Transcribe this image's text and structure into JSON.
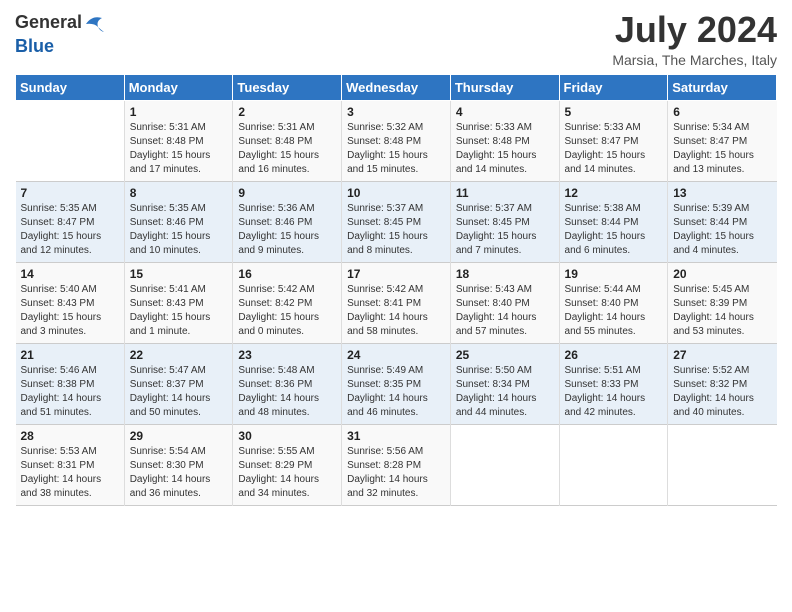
{
  "header": {
    "logo_general": "General",
    "logo_blue": "Blue",
    "month_year": "July 2024",
    "location": "Marsia, The Marches, Italy"
  },
  "days_of_week": [
    "Sunday",
    "Monday",
    "Tuesday",
    "Wednesday",
    "Thursday",
    "Friday",
    "Saturday"
  ],
  "weeks": [
    [
      {
        "num": "",
        "info": ""
      },
      {
        "num": "1",
        "info": "Sunrise: 5:31 AM\nSunset: 8:48 PM\nDaylight: 15 hours\nand 17 minutes."
      },
      {
        "num": "2",
        "info": "Sunrise: 5:31 AM\nSunset: 8:48 PM\nDaylight: 15 hours\nand 16 minutes."
      },
      {
        "num": "3",
        "info": "Sunrise: 5:32 AM\nSunset: 8:48 PM\nDaylight: 15 hours\nand 15 minutes."
      },
      {
        "num": "4",
        "info": "Sunrise: 5:33 AM\nSunset: 8:48 PM\nDaylight: 15 hours\nand 14 minutes."
      },
      {
        "num": "5",
        "info": "Sunrise: 5:33 AM\nSunset: 8:47 PM\nDaylight: 15 hours\nand 14 minutes."
      },
      {
        "num": "6",
        "info": "Sunrise: 5:34 AM\nSunset: 8:47 PM\nDaylight: 15 hours\nand 13 minutes."
      }
    ],
    [
      {
        "num": "7",
        "info": "Sunrise: 5:35 AM\nSunset: 8:47 PM\nDaylight: 15 hours\nand 12 minutes."
      },
      {
        "num": "8",
        "info": "Sunrise: 5:35 AM\nSunset: 8:46 PM\nDaylight: 15 hours\nand 10 minutes."
      },
      {
        "num": "9",
        "info": "Sunrise: 5:36 AM\nSunset: 8:46 PM\nDaylight: 15 hours\nand 9 minutes."
      },
      {
        "num": "10",
        "info": "Sunrise: 5:37 AM\nSunset: 8:45 PM\nDaylight: 15 hours\nand 8 minutes."
      },
      {
        "num": "11",
        "info": "Sunrise: 5:37 AM\nSunset: 8:45 PM\nDaylight: 15 hours\nand 7 minutes."
      },
      {
        "num": "12",
        "info": "Sunrise: 5:38 AM\nSunset: 8:44 PM\nDaylight: 15 hours\nand 6 minutes."
      },
      {
        "num": "13",
        "info": "Sunrise: 5:39 AM\nSunset: 8:44 PM\nDaylight: 15 hours\nand 4 minutes."
      }
    ],
    [
      {
        "num": "14",
        "info": "Sunrise: 5:40 AM\nSunset: 8:43 PM\nDaylight: 15 hours\nand 3 minutes."
      },
      {
        "num": "15",
        "info": "Sunrise: 5:41 AM\nSunset: 8:43 PM\nDaylight: 15 hours\nand 1 minute."
      },
      {
        "num": "16",
        "info": "Sunrise: 5:42 AM\nSunset: 8:42 PM\nDaylight: 15 hours\nand 0 minutes."
      },
      {
        "num": "17",
        "info": "Sunrise: 5:42 AM\nSunset: 8:41 PM\nDaylight: 14 hours\nand 58 minutes."
      },
      {
        "num": "18",
        "info": "Sunrise: 5:43 AM\nSunset: 8:40 PM\nDaylight: 14 hours\nand 57 minutes."
      },
      {
        "num": "19",
        "info": "Sunrise: 5:44 AM\nSunset: 8:40 PM\nDaylight: 14 hours\nand 55 minutes."
      },
      {
        "num": "20",
        "info": "Sunrise: 5:45 AM\nSunset: 8:39 PM\nDaylight: 14 hours\nand 53 minutes."
      }
    ],
    [
      {
        "num": "21",
        "info": "Sunrise: 5:46 AM\nSunset: 8:38 PM\nDaylight: 14 hours\nand 51 minutes."
      },
      {
        "num": "22",
        "info": "Sunrise: 5:47 AM\nSunset: 8:37 PM\nDaylight: 14 hours\nand 50 minutes."
      },
      {
        "num": "23",
        "info": "Sunrise: 5:48 AM\nSunset: 8:36 PM\nDaylight: 14 hours\nand 48 minutes."
      },
      {
        "num": "24",
        "info": "Sunrise: 5:49 AM\nSunset: 8:35 PM\nDaylight: 14 hours\nand 46 minutes."
      },
      {
        "num": "25",
        "info": "Sunrise: 5:50 AM\nSunset: 8:34 PM\nDaylight: 14 hours\nand 44 minutes."
      },
      {
        "num": "26",
        "info": "Sunrise: 5:51 AM\nSunset: 8:33 PM\nDaylight: 14 hours\nand 42 minutes."
      },
      {
        "num": "27",
        "info": "Sunrise: 5:52 AM\nSunset: 8:32 PM\nDaylight: 14 hours\nand 40 minutes."
      }
    ],
    [
      {
        "num": "28",
        "info": "Sunrise: 5:53 AM\nSunset: 8:31 PM\nDaylight: 14 hours\nand 38 minutes."
      },
      {
        "num": "29",
        "info": "Sunrise: 5:54 AM\nSunset: 8:30 PM\nDaylight: 14 hours\nand 36 minutes."
      },
      {
        "num": "30",
        "info": "Sunrise: 5:55 AM\nSunset: 8:29 PM\nDaylight: 14 hours\nand 34 minutes."
      },
      {
        "num": "31",
        "info": "Sunrise: 5:56 AM\nSunset: 8:28 PM\nDaylight: 14 hours\nand 32 minutes."
      },
      {
        "num": "",
        "info": ""
      },
      {
        "num": "",
        "info": ""
      },
      {
        "num": "",
        "info": ""
      }
    ]
  ]
}
